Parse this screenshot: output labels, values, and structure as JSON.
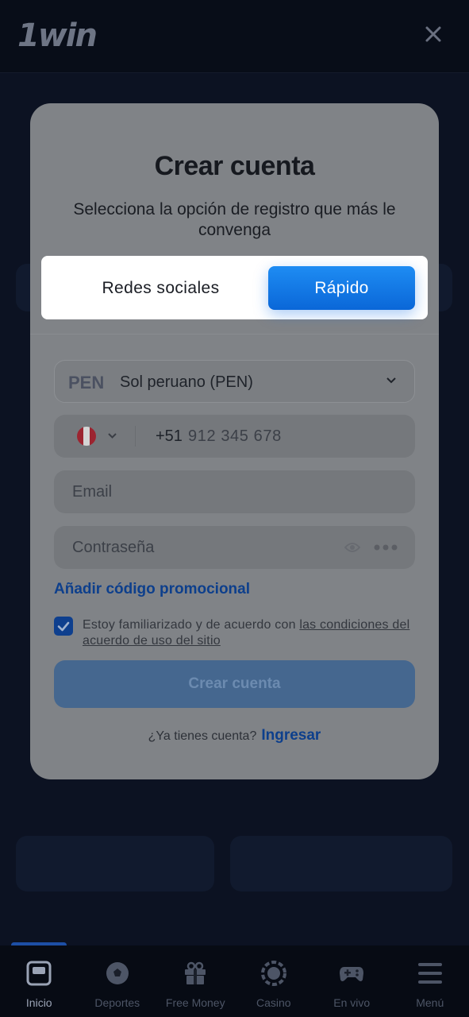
{
  "header": {
    "logo": "1win",
    "close_icon": "close-icon"
  },
  "modal": {
    "title": "Crear cuenta",
    "subtitle": "Selecciona la opción de registro que más le convenga",
    "tabs": [
      {
        "label": "Redes sociales",
        "selected": false
      },
      {
        "label": "Rápido",
        "selected": true
      }
    ],
    "currency": {
      "code": "PEN",
      "name": "Sol peruano (PEN)",
      "icon": "chevron-down-icon"
    },
    "phone": {
      "country_icon": "peru-flag-icon",
      "code": "+51",
      "placeholder": "912 345 678"
    },
    "email": {
      "placeholder": "Email"
    },
    "password": {
      "placeholder": "Contraseña",
      "icons": [
        "eye-icon",
        "more-dots-icon"
      ]
    },
    "promo_link": "Añadir código promocional",
    "terms": {
      "checked": true,
      "text": "Estoy familiarizado y de acuerdo con ",
      "link": "las condiciones del acuerdo de uso del sitio"
    },
    "submit_label": "Crear cuenta",
    "login_prompt": "¿Ya tienes cuenta?",
    "login_link": "Ingresar"
  },
  "bottom_nav": {
    "items": [
      {
        "label": "Inicio",
        "icon": "home-icon",
        "active": true
      },
      {
        "label": "Deportes",
        "icon": "soccer-ball-icon",
        "active": false
      },
      {
        "label": "Free Money",
        "icon": "gift-icon",
        "active": false
      },
      {
        "label": "Casino",
        "icon": "casino-chip-icon",
        "active": false
      },
      {
        "label": "En vivo",
        "icon": "gamepad-icon",
        "active": false
      },
      {
        "label": "Menú",
        "icon": "menu-icon",
        "active": false
      }
    ]
  },
  "colors": {
    "accent": "#0a67d8",
    "link": "#0d3f8c",
    "background": "#0b1120"
  }
}
